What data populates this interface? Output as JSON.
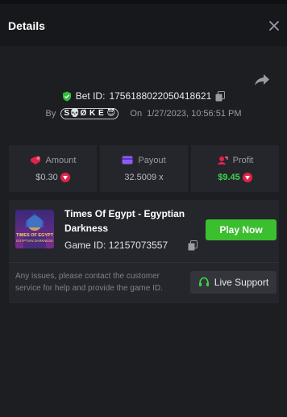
{
  "header": {
    "title": "Details"
  },
  "bet": {
    "id_label": "Bet ID:",
    "id_value": "1756188022050418621",
    "by_label": "By",
    "user": "S💀Ø K E 😈",
    "on_label": "On",
    "datetime": "1/27/2023, 10:56:51 PM"
  },
  "stats": {
    "amount": {
      "label": "Amount",
      "value": "$0.30"
    },
    "payout": {
      "label": "Payout",
      "value": "32.5009 x"
    },
    "profit": {
      "label": "Profit",
      "value": "$9.45"
    }
  },
  "game": {
    "name": "Times Of Egypt - Egyptian Darkness",
    "id_label": "Game ID:",
    "id_value": "12157073557",
    "thumb_line1": "TIMES OF EGYPT",
    "thumb_line2": "EGYPTIAN DARKNESS",
    "play_label": "Play Now"
  },
  "support": {
    "text": "Any issues, please contact the customer service for help and provide the game ID.",
    "button_label": "Live Support"
  },
  "colors": {
    "accent_green": "#3bbf2f",
    "profit_green": "#3ed44b",
    "coin_red": "#e0234a",
    "payout_purple": "#8b5cf6",
    "amount_red": "#e0234a"
  }
}
